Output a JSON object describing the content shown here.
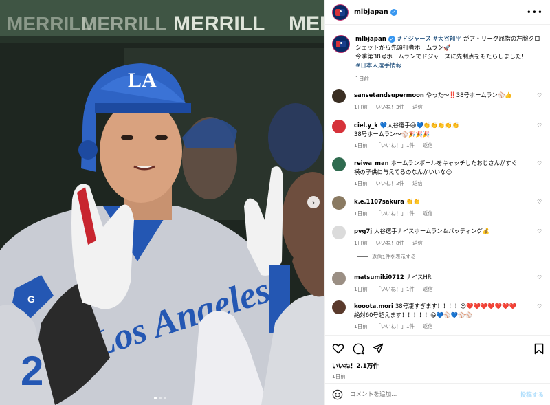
{
  "photo": {
    "banner_texts": [
      "MERRILL",
      "MERRILL",
      "MERRILL",
      "MER"
    ],
    "helmet_logo": "LA",
    "jersey_text": "Los Angeles",
    "next_icon": "chevron-right-icon",
    "slide_count": 3,
    "slide_active": 1
  },
  "header": {
    "username": "mlbjapan",
    "more_icon": "more-horizontal-icon"
  },
  "caption": {
    "username": "mlbjapan",
    "parts": [
      {
        "text": " ",
        "kind": "text"
      },
      {
        "text": "#ドジャース",
        "kind": "tag"
      },
      {
        "text": " ",
        "kind": "text"
      },
      {
        "text": "#大谷翔平",
        "kind": "tag"
      },
      {
        "text": " がア・リーグ屈指の左腕クロシェットから先頭打者ホームラン🚀",
        "kind": "text"
      }
    ],
    "line2": "今季第38号ホームランでドジャースに先制点をもたらしました！",
    "tag3": "#日本人選手情報",
    "time": "1日前"
  },
  "comments": [
    {
      "user": "sansetandsupermoon",
      "text": "やった〜‼️38号ホームラン⚾👍",
      "time": "1日前",
      "likes": "いいね！3件",
      "reply": "返信",
      "avatar_color": "#3a2e22"
    },
    {
      "user": "ciel.y_k",
      "text": "💙大谷選手😆💙👏👏👏👏👏",
      "text2": "38号ホームラン〜⚾🎉🎉🎉",
      "time": "1日前",
      "likes": "「いいね！」1件",
      "reply": "返信",
      "avatar_color": "#d6323a"
    },
    {
      "user": "reiwa_man",
      "text": "ホームランボールをキャッチしたおじさんがすぐ",
      "text2": "横の子供に与えてるのなんかいいな😊",
      "time": "1日前",
      "likes": "いいね！2件",
      "reply": "返信",
      "avatar_color": "#2f6b4f"
    },
    {
      "user": "k.e.1107sakura",
      "text": "👏👏",
      "time": "1日前",
      "likes": "「いいね！」1件",
      "reply": "返信",
      "avatar_color": "#8a7a62"
    },
    {
      "user": "pvg7j",
      "text": "大谷選手ナイスホームラン＆バッティング💰",
      "time": "1日前",
      "likes": "いいね！8件",
      "reply": "返信",
      "avatar_color": "#dbdbdb"
    },
    {
      "user": "matsumiki0712",
      "text": "ナイスHR",
      "time": "1日前",
      "likes": "「いいね！」1件",
      "reply": "返信",
      "avatar_color": "#9b8f84"
    },
    {
      "user": "kooota.mori",
      "text": "38号凄すぎます！！！！😍❤️❤️❤️❤️❤️❤️❤️",
      "text2": "絶対60号超えます！！！！！😆💙⚾💙⚾⚾",
      "time": "1日前",
      "likes": "「いいね！」1件",
      "reply": "返信",
      "avatar_color": "#5a3a2c"
    }
  ],
  "replies_toggle": "返信1件を表示する",
  "actions": {
    "like_icon": "heart-icon",
    "comment_icon": "comment-icon",
    "share_icon": "send-icon",
    "save_icon": "bookmark-icon",
    "likes": "いいね！2.1万件",
    "time": "1日前"
  },
  "composer": {
    "emoji_icon": "emoji-icon",
    "placeholder": "コメントを追加...",
    "post_label": "投稿する"
  }
}
